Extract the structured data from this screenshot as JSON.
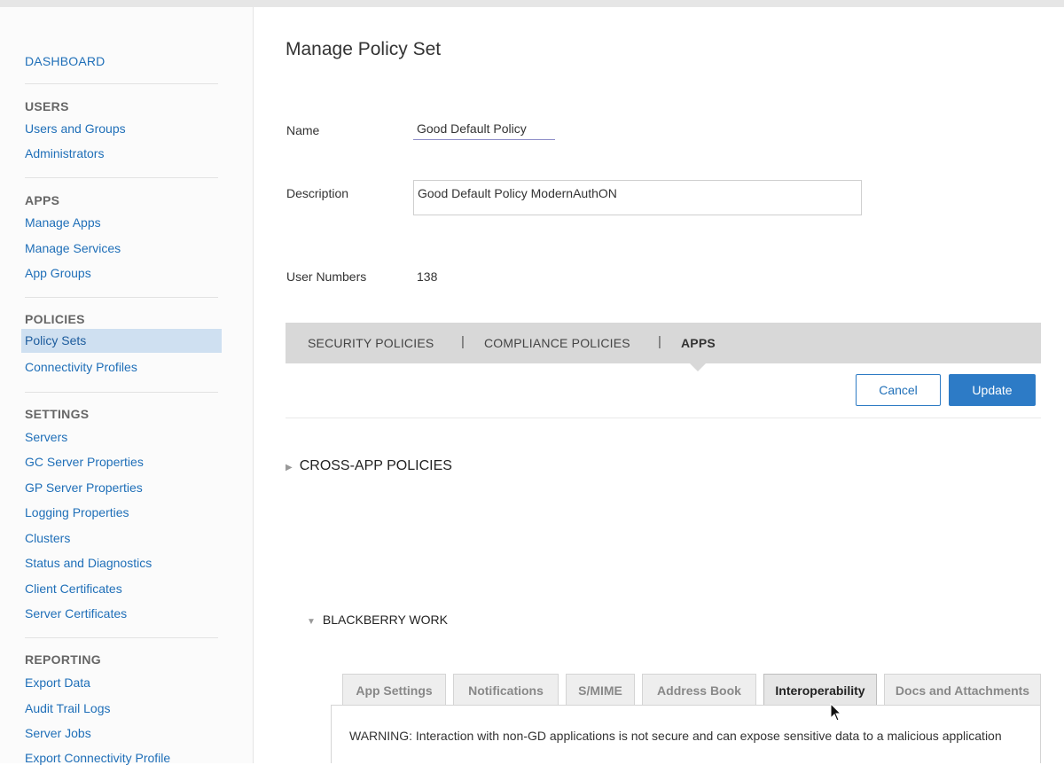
{
  "sidebar": {
    "dashboard": "DASHBOARD",
    "sections": [
      {
        "header": "USERS",
        "items": [
          "Users and Groups",
          "Administrators"
        ]
      },
      {
        "header": "APPS",
        "items": [
          "Manage Apps",
          "Manage Services",
          "App Groups"
        ]
      },
      {
        "header": "POLICIES",
        "items": [
          "Policy Sets",
          "Connectivity Profiles"
        ]
      },
      {
        "header": "SETTINGS",
        "items": [
          "Servers",
          "GC Server Properties",
          "GP Server Properties",
          "Logging Properties",
          "Clusters",
          "Status and Diagnostics",
          "Client Certificates",
          "Server Certificates"
        ]
      },
      {
        "header": "REPORTING",
        "items": [
          "Export Data",
          "Audit Trail Logs",
          "Server Jobs",
          "Export Connectivity Profile"
        ]
      }
    ],
    "active_item": "Policy Sets"
  },
  "main": {
    "title": "Manage Policy Set",
    "name_label": "Name",
    "name_value": "Good Default Policy",
    "description_label": "Description",
    "description_value": "Good Default Policy ModernAuthON",
    "user_numbers_label": "User Numbers",
    "user_numbers_value": "138",
    "tabs": [
      {
        "label": "SECURITY POLICIES",
        "active": false
      },
      {
        "label": "COMPLIANCE POLICIES",
        "active": false
      },
      {
        "label": "APPS",
        "active": true
      }
    ],
    "cancel_label": "Cancel",
    "update_label": "Update",
    "cross_app_label": "CROSS-APP POLICIES",
    "blackberry_work_label": "BLACKBERRY WORK",
    "subtabs": [
      {
        "label": "App Settings",
        "active": false
      },
      {
        "label": "Notifications",
        "active": false
      },
      {
        "label": "S/MIME",
        "active": false
      },
      {
        "label": "Address Book",
        "active": false
      },
      {
        "label": "Interoperability",
        "active": true
      },
      {
        "label": "Docs and Attachments",
        "active": false
      }
    ],
    "warning_text": "WARNING: Interaction with non-GD applications is not secure and can expose sensitive data to a malicious application"
  },
  "icons": {
    "collapsed_arrow": "triangle-right-icon",
    "expanded_arrow": "triangle-down-icon",
    "cursor": "mouse-pointer-icon"
  },
  "colors": {
    "link": "#1f6fb8",
    "active_bg": "#cfe0f1",
    "primary_button": "#2d7bc6",
    "tabbar_bg": "#d8d8d8"
  }
}
